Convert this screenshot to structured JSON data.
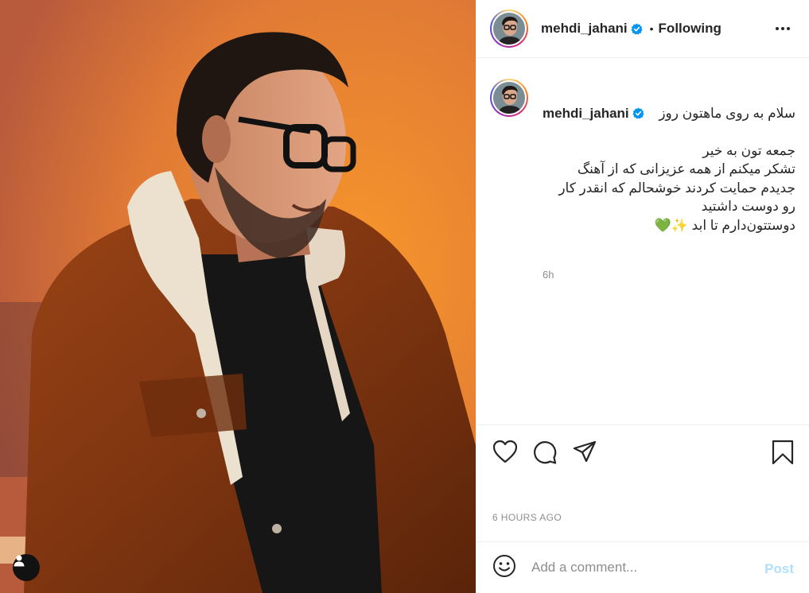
{
  "post": {
    "username": "mehdi_jahani",
    "verified_icon": "verified-badge-icon",
    "separator": "•",
    "follow_status": "Following",
    "caption": {
      "username": "mehdi_jahani",
      "line1": "سلام به روی ماهتون روز",
      "body": "جمعه تون به خیر\nتشکر میکنم از همه عزیزانی که از آهنگ جدیدم حمایت کردند خوشحالم که انقدر کار رو دوست داشتید\nدوستتون‌دارم تا ابد ✨💚",
      "relative_time": "6h"
    },
    "posted_time": "6 HOURS AGO"
  },
  "comment": {
    "placeholder": "Add a comment...",
    "post_label": "Post"
  },
  "colors": {
    "verified_blue": "#0095f6",
    "post_button_disabled": "#b2dffc",
    "photo_background": "#e3803a"
  }
}
